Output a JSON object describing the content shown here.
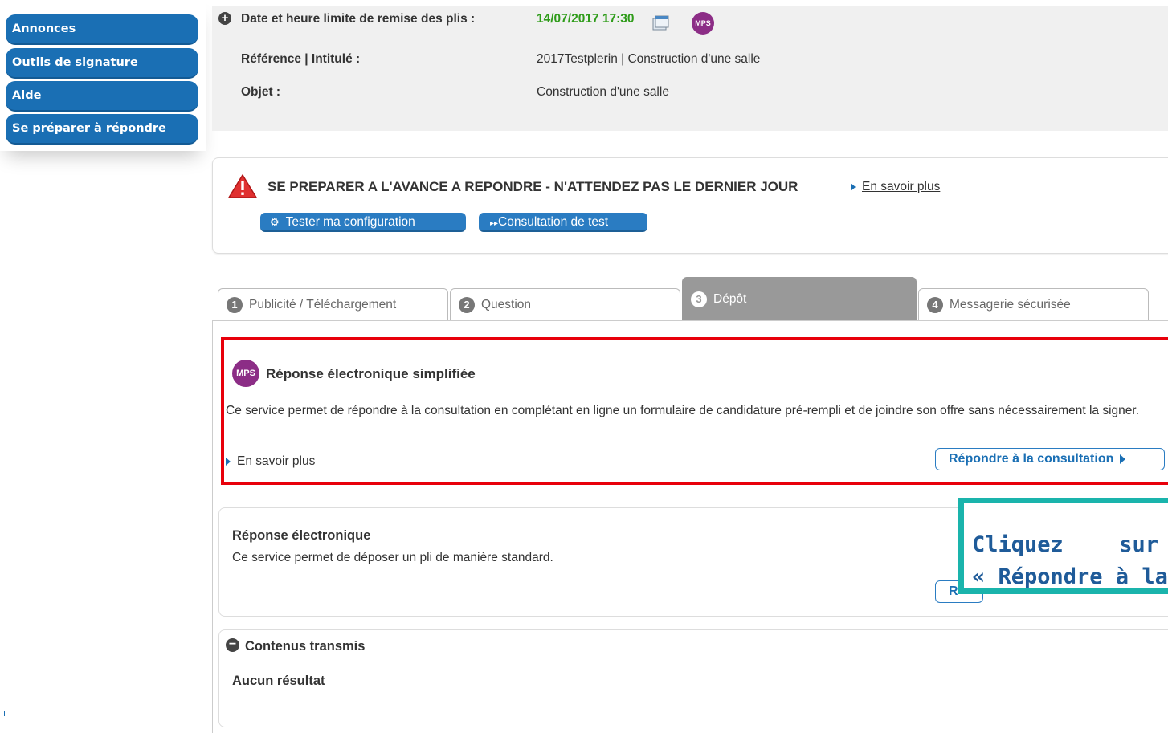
{
  "sidebar": {
    "items": [
      {
        "label": "Annonces"
      },
      {
        "label": "Outils de signature"
      },
      {
        "label": "Aide"
      },
      {
        "label": "Se préparer à répondre"
      }
    ]
  },
  "info": {
    "deadline_label": "Date et heure limite de remise des plis :",
    "deadline_value": "14/07/2017 17:30",
    "reference_label": "Référence | Intitulé :",
    "reference_value": "2017Testplerin | Construction d'une salle",
    "objet_label": "Objet :",
    "objet_value": "Construction d'une salle",
    "mps_badge": "MPS"
  },
  "warning": {
    "title": "SE PREPARER A L'AVANCE A REPONDRE - N'ATTENDEZ PAS LE DERNIER JOUR",
    "learn_more": "En savoir plus",
    "test_config_button": "Tester ma configuration",
    "test_consultation_button": "Consultation de test"
  },
  "tabs": [
    {
      "num": "1",
      "label": "Publicité / Téléchargement",
      "active": false
    },
    {
      "num": "2",
      "label": "Question",
      "active": false
    },
    {
      "num": "3",
      "label": "Dépôt",
      "active": true
    },
    {
      "num": "4",
      "label": "Messagerie sécurisée",
      "active": false
    }
  ],
  "mps_panel": {
    "badge": "MPS",
    "title": "Réponse électronique simplifiée",
    "description": "Ce service permet de répondre à la consultation en complétant en ligne un formulaire de candidature pré-rempli et de joindre son offre sans nécessairement la signer.",
    "learn_more": "En savoir plus",
    "respond_button": "Répondre à la consultation"
  },
  "standard_panel": {
    "title": "Réponse électronique",
    "description": "Ce service permet de déposer un pli de manière standard.",
    "respond_button_partial": "R"
  },
  "contents_panel": {
    "title": "Contenus transmis",
    "empty_text": "Aucun résultat"
  },
  "callout": {
    "line1_a": "Cliquez",
    "line1_b": "sur",
    "line2": "« Répondre à la"
  },
  "colors": {
    "accent": "#1a6fb4",
    "date_green": "#2f9c1a",
    "highlight_red": "#e8000b",
    "callout_teal": "#1ab4ac",
    "mps_purple": "#8c2d86"
  }
}
